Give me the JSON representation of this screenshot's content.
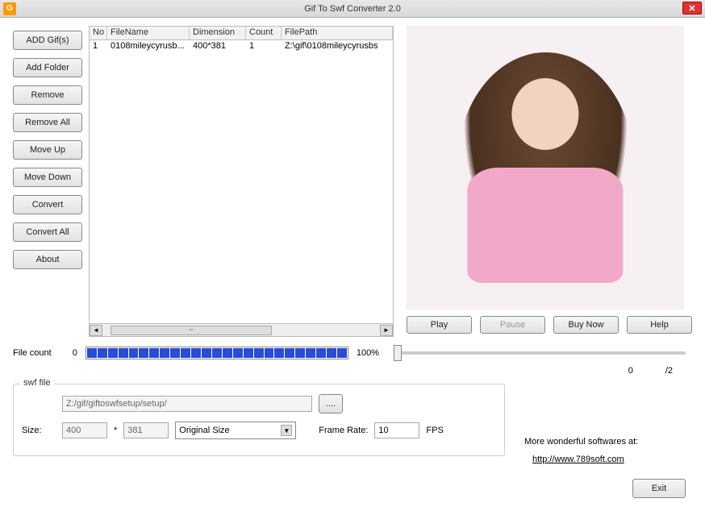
{
  "titlebar": {
    "title": "Gif To Swf Converter 2.0",
    "app_icon": "G"
  },
  "sidebar": {
    "add_gifs": "ADD Gif(s)",
    "add_folder": "Add Folder",
    "remove": "Remove",
    "remove_all": "Remove All",
    "move_up": "Move Up",
    "move_down": "Move Down",
    "convert": "Convert",
    "convert_all": "Convert All",
    "about": "About"
  },
  "list": {
    "headers": {
      "no": "No",
      "filename": "FileName",
      "dimension": "Dimension",
      "count": "Count",
      "filepath": "FilePath"
    },
    "rows": [
      {
        "no": "1",
        "filename": "0108mileycyrusb...",
        "dimension": "400*381",
        "count": "1",
        "filepath": "Z:\\gif\\0108mileycyrusbs"
      }
    ]
  },
  "preview_buttons": {
    "play": "Play",
    "pause": "Pause",
    "buy_now": "Buy Now",
    "help": "Help"
  },
  "status": {
    "file_count_label": "File count",
    "file_count_value": "0",
    "progress_pct": "100%"
  },
  "frames": {
    "current": "0",
    "total": "/2"
  },
  "swf": {
    "legend": "swf file",
    "path": "Z:/gif/giftoswfsetup/setup/",
    "browse": "....",
    "size_label": "Size:",
    "width": "400",
    "times": "*",
    "height": "381",
    "mode": "Original Size",
    "framerate_label": "Frame Rate:",
    "framerate": "10",
    "fps": "FPS"
  },
  "footer": {
    "more_label": "More wonderful softwares at:",
    "link": "http://www.789soft.com",
    "exit": "Exit"
  }
}
